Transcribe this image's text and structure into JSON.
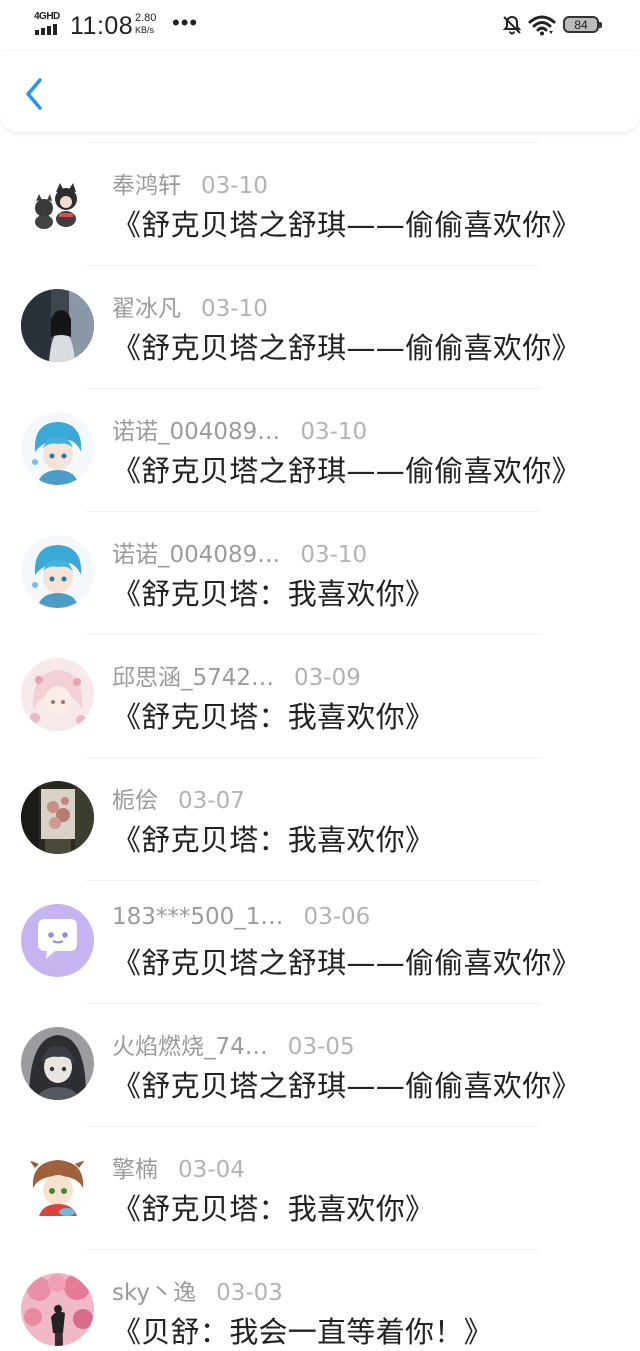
{
  "status_bar": {
    "network": "4GHD",
    "time": "11:08",
    "speed_value": "2.80",
    "speed_unit": "KB/s",
    "more": "•••",
    "battery": "84"
  },
  "header": {
    "back_icon": "chevron-left-icon",
    "accent_color": "#2196f3"
  },
  "items": [
    {
      "name": "奉鸿轩",
      "date": "03-10",
      "title": "《舒克贝塔之舒琪——偷偷喜欢你》",
      "avatar": "cats-avatar"
    },
    {
      "name": "翟冰凡",
      "date": "03-10",
      "title": "《舒克贝塔之舒琪——偷偷喜欢你》",
      "avatar": "photo-avatar"
    },
    {
      "name": "诺诺_004089…",
      "date": "03-10",
      "title": "《舒克贝塔之舒琪——偷偷喜欢你》",
      "avatar": "anime-blue-avatar"
    },
    {
      "name": "诺诺_004089…",
      "date": "03-10",
      "title": "《舒克贝塔：我喜欢你》",
      "avatar": "anime-blue-avatar"
    },
    {
      "name": "邱思涵_5742…",
      "date": "03-09",
      "title": "《舒克贝塔：我喜欢你》",
      "avatar": "anime-pink-avatar"
    },
    {
      "name": "栀侩",
      "date": "03-07",
      "title": "《舒克贝塔：我喜欢你》",
      "avatar": "flower-photo-avatar"
    },
    {
      "name": "183***500_1…",
      "date": "03-06",
      "title": "《舒克贝塔之舒琪——偷偷喜欢你》",
      "avatar": "default-chat-avatar"
    },
    {
      "name": "火焰燃烧_74…",
      "date": "03-05",
      "title": "《舒克贝塔之舒琪——偷偷喜欢你》",
      "avatar": "anime-dark-avatar"
    },
    {
      "name": "擎楠",
      "date": "03-04",
      "title": "《舒克贝塔：我喜欢你》",
      "avatar": "anime-boy-avatar"
    },
    {
      "name": "sky丶逸",
      "date": "03-03",
      "title": "《贝舒：我会一直等着你！》",
      "avatar": "pink-tree-avatar"
    }
  ]
}
